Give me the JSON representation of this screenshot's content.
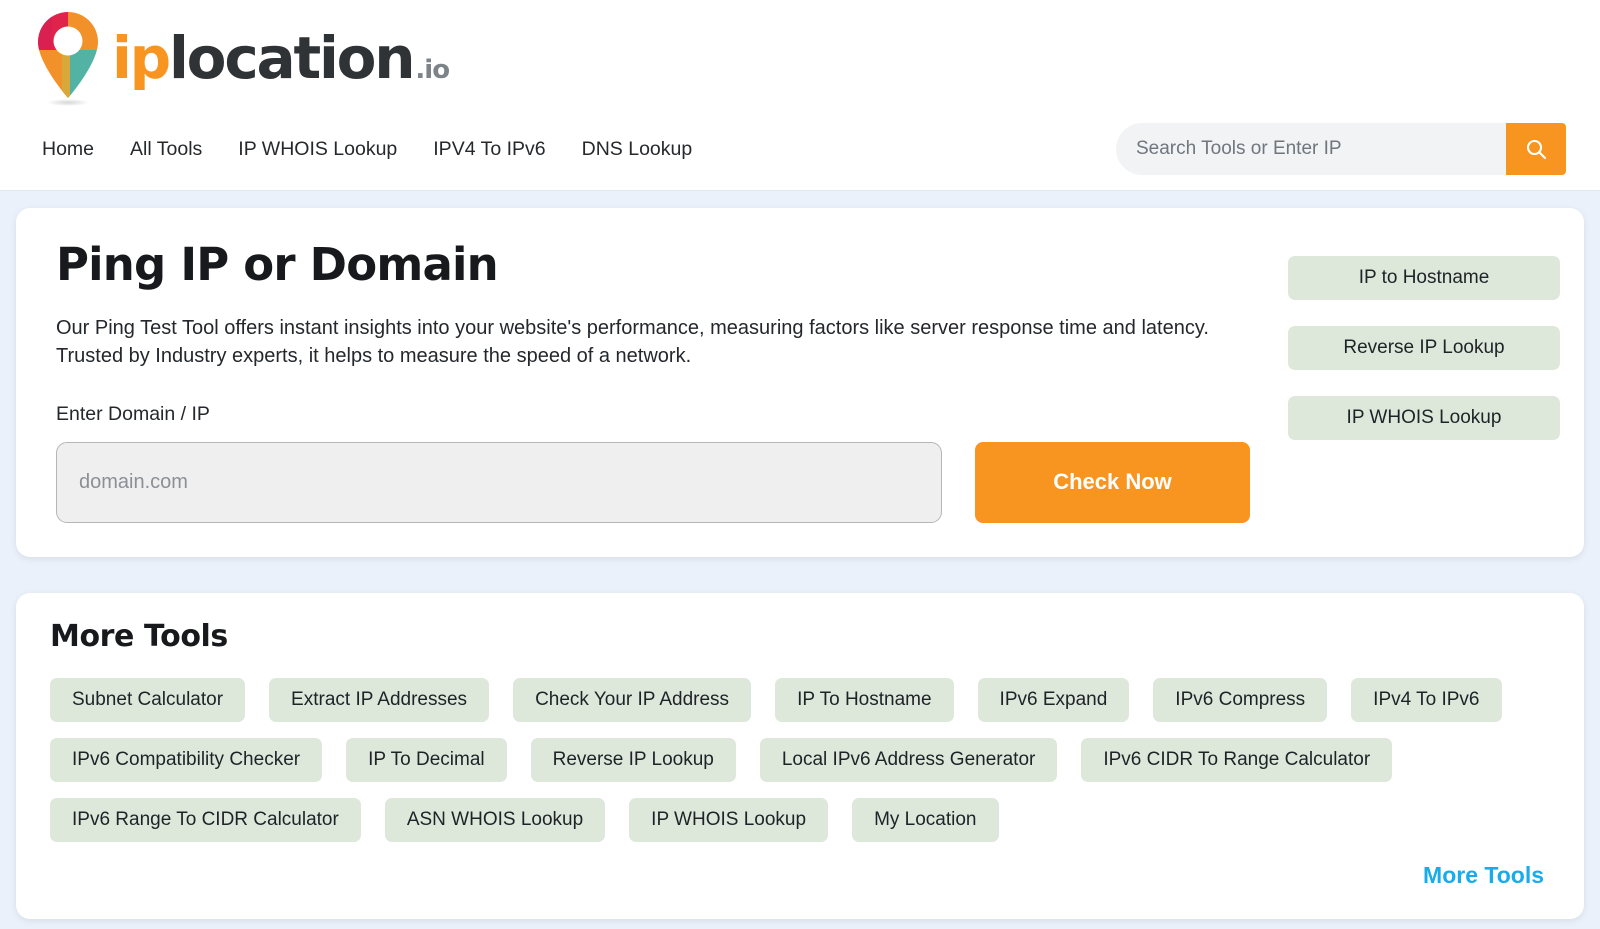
{
  "brand": {
    "logo_ip": "ip",
    "logo_location": "location",
    "logo_tld": ".io",
    "pin_colors": {
      "crimson": "#e0234b",
      "orange": "#f2912a",
      "teal": "#52b3a4",
      "amber": "#d8a83b"
    }
  },
  "nav": {
    "items": [
      {
        "label": "Home"
      },
      {
        "label": "All Tools"
      },
      {
        "label": "IP WHOIS Lookup"
      },
      {
        "label": "IPV4 To IPv6"
      },
      {
        "label": "DNS Lookup"
      }
    ]
  },
  "search": {
    "placeholder": "Search Tools or Enter IP",
    "value": "",
    "icon": "search-icon",
    "button_color": "#f89520"
  },
  "tool": {
    "title": "Ping IP or Domain",
    "description": "Our Ping Test Tool offers instant insights into your website's performance, measuring factors like server response time and latency. Trusted by Industry experts, it helps to measure the speed of a network.",
    "field_label": "Enter Domain / IP",
    "input_placeholder": "domain.com",
    "input_value": "",
    "submit_label": "Check Now"
  },
  "side_links": [
    {
      "label": "IP to Hostname"
    },
    {
      "label": "Reverse IP Lookup"
    },
    {
      "label": "IP WHOIS Lookup"
    }
  ],
  "more_tools": {
    "title": "More Tools",
    "rows": [
      [
        {
          "label": "Subnet Calculator"
        },
        {
          "label": "Extract IP Addresses"
        },
        {
          "label": "Check Your IP Address"
        },
        {
          "label": "IP To Hostname"
        },
        {
          "label": "IPv6 Expand"
        },
        {
          "label": "IPv6 Compress"
        },
        {
          "label": "IPv4 To IPv6"
        }
      ],
      [
        {
          "label": "IPv6 Compatibility Checker"
        },
        {
          "label": "IP To Decimal"
        },
        {
          "label": "Reverse IP Lookup"
        },
        {
          "label": "Local IPv6 Address Generator"
        },
        {
          "label": "IPv6 CIDR To Range Calculator"
        }
      ],
      [
        {
          "label": "IPv6 Range To CIDR Calculator"
        },
        {
          "label": "ASN WHOIS Lookup"
        },
        {
          "label": "IP WHOIS Lookup"
        },
        {
          "label": "My Location"
        }
      ]
    ],
    "footer_link": "More Tools",
    "footer_link_color": "#18acec",
    "chip_color": "#dde8db"
  },
  "theme": {
    "page_background": "#eaf1fa",
    "card_background": "#ffffff",
    "accent": "#f89520"
  }
}
